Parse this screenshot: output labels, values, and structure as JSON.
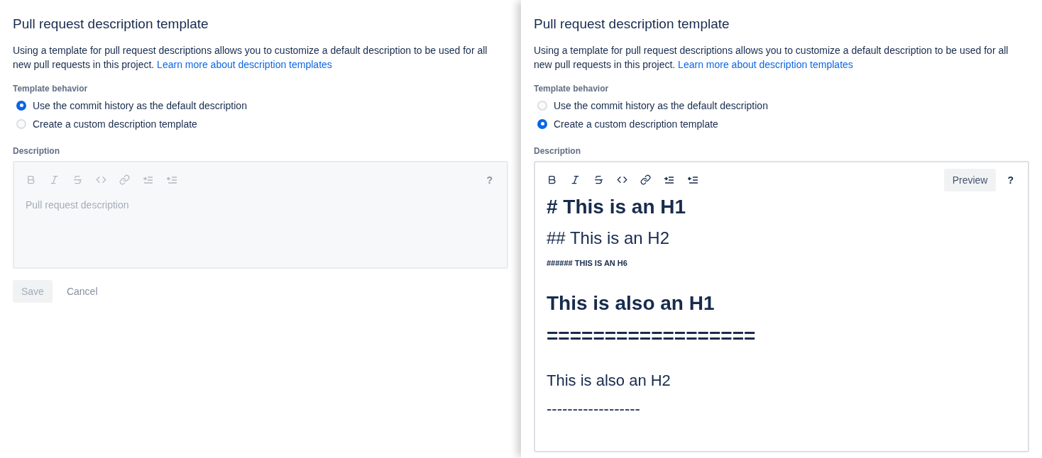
{
  "panels": [
    {
      "title": "Pull request description template",
      "intro": "Using a template for pull request descriptions allows you to customize a default description to be used for all new pull requests in this project.",
      "link": "Learn more about description templates",
      "behavior_label": "Template behavior",
      "options": [
        {
          "label": "Use the commit history as the default description",
          "selected": true
        },
        {
          "label": "Create a custom description template",
          "selected": false
        }
      ],
      "description_label": "Description",
      "editor": {
        "disabled": true,
        "help": "?",
        "placeholder": "Pull request description"
      },
      "actions": [
        {
          "label": "Save",
          "kind": "primary",
          "disabled": true
        },
        {
          "label": "Cancel",
          "kind": "subtle",
          "disabled": false
        }
      ],
      "raised": false
    },
    {
      "title": "Pull request description template",
      "intro": "Using a template for pull request descriptions allows you to customize a default description to be used for all new pull requests in this project.",
      "link": "Learn more about description templates",
      "behavior_label": "Template behavior",
      "options": [
        {
          "label": "Use the commit history as the default description",
          "selected": false
        },
        {
          "label": "Create a custom description template",
          "selected": true
        }
      ],
      "description_label": "Description",
      "editor": {
        "disabled": false,
        "preview_button": "Preview",
        "help": "?",
        "lines": [
          {
            "text": "# This is an H1",
            "kind": "h1"
          },
          {
            "text": "## This is an H2",
            "kind": "h2"
          },
          {
            "text": "###### THIS IS AN H6",
            "kind": "h6"
          },
          {
            "text": "This is also an H1",
            "kind": "h1"
          },
          {
            "text": "==================",
            "kind": "h1-rule"
          },
          {
            "text": "This is also an H2",
            "kind": "h2-plain"
          },
          {
            "text": "------------------",
            "kind": "h2-rule"
          }
        ]
      },
      "raised": true
    }
  ]
}
